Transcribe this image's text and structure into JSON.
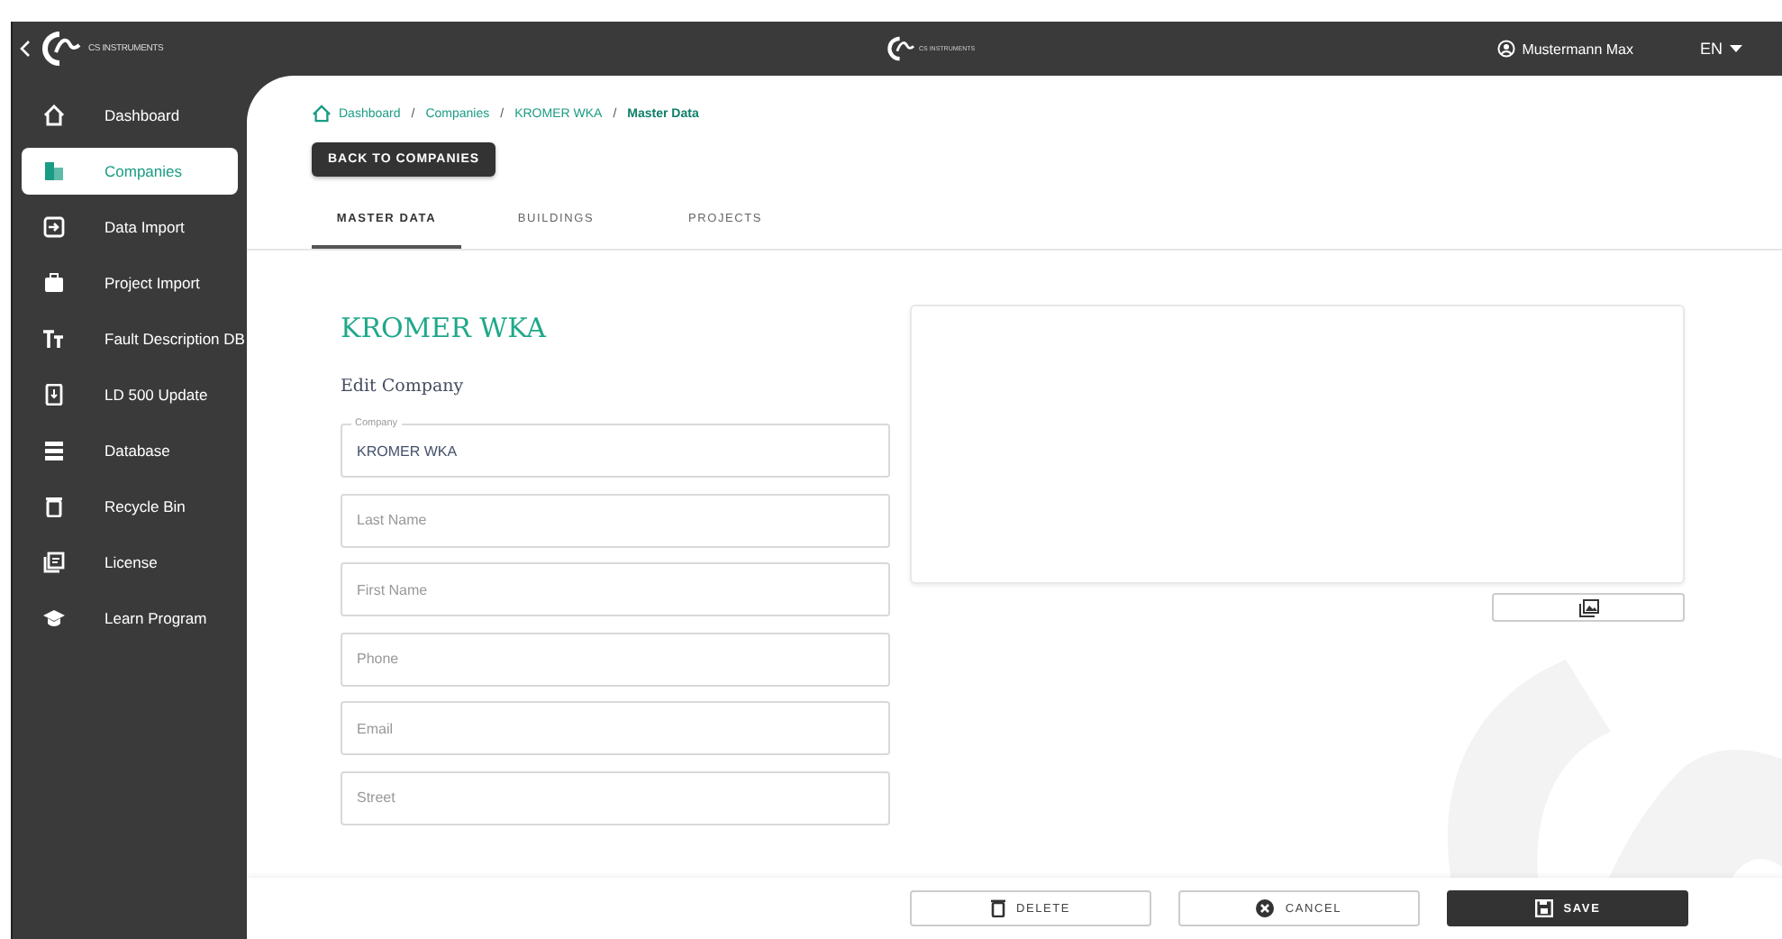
{
  "brand": {
    "sidebar_logo_text": "CS INSTRUMENTS",
    "header_logo_text": "CS INSTRUMENTS"
  },
  "header": {
    "user": "Mustermann Max",
    "language": "EN"
  },
  "sidebar": {
    "items": [
      {
        "label": "Dashboard",
        "selected": false
      },
      {
        "label": "Companies",
        "selected": true
      },
      {
        "label": "Data Import",
        "selected": false
      },
      {
        "label": "Project Import",
        "selected": false
      },
      {
        "label": "Fault Description DB",
        "selected": false
      },
      {
        "label": "LD 500 Update",
        "selected": false
      },
      {
        "label": "Database",
        "selected": false
      },
      {
        "label": "Recycle Bin",
        "selected": false
      },
      {
        "label": "License",
        "selected": false
      },
      {
        "label": "Learn Program",
        "selected": false
      }
    ]
  },
  "breadcrumb": [
    "Dashboard",
    "Companies",
    "KROMER WKA",
    "Master Data"
  ],
  "breadcrumb_separator": "/",
  "back_button": "BACK TO COMPANIES",
  "tabs": [
    {
      "label": "MASTER DATA",
      "selected": true
    },
    {
      "label": "BUILDINGS",
      "selected": false
    },
    {
      "label": "PROJECTS",
      "selected": false
    }
  ],
  "title": "KROMER WKA",
  "subtitle": "Edit Company",
  "fields": [
    {
      "label": "Company",
      "value": "KROMER WKA"
    },
    {
      "placeholder": "Last Name"
    },
    {
      "placeholder": "First Name"
    },
    {
      "placeholder": "Phone"
    },
    {
      "placeholder": "Email"
    },
    {
      "placeholder": "Street"
    }
  ],
  "actions": [
    {
      "label": "DELETE",
      "kind": "delete"
    },
    {
      "label": "CANCEL",
      "kind": "cancel"
    },
    {
      "label": "SAVE",
      "kind": "save"
    }
  ]
}
